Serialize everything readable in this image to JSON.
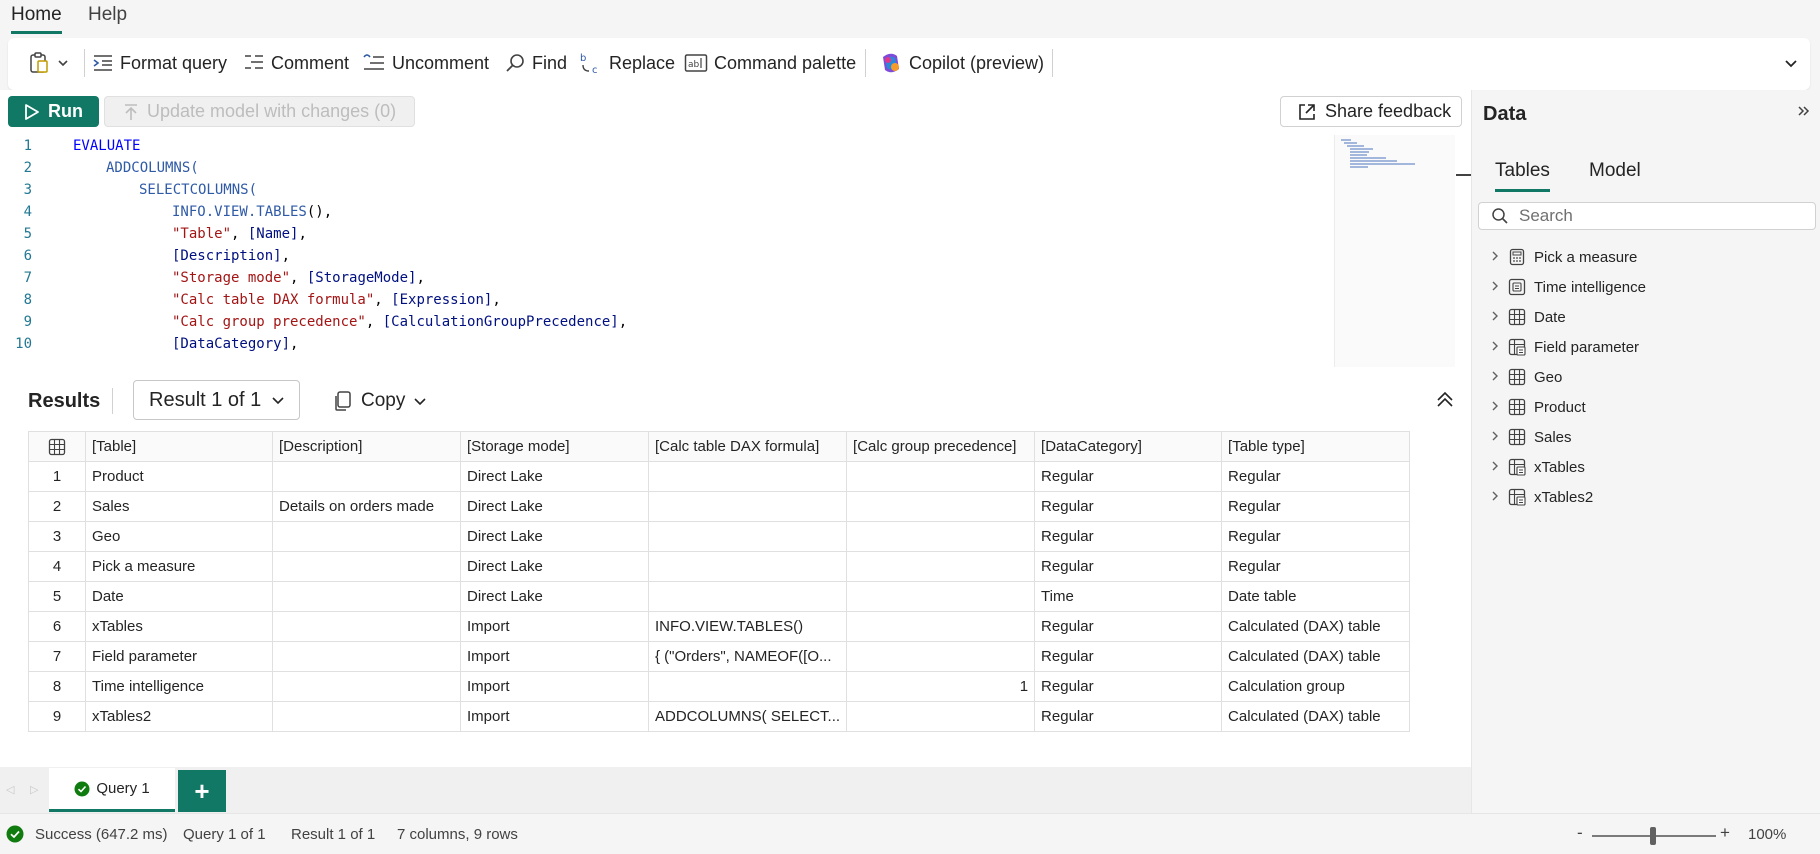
{
  "menu": {
    "tabs": [
      {
        "label": "Home"
      },
      {
        "label": "Help"
      }
    ]
  },
  "ribbon": {
    "format_query": "Format query",
    "comment": "Comment",
    "uncomment": "Uncomment",
    "find": "Find",
    "replace": "Replace",
    "command_palette": "Command palette",
    "copilot": "Copilot (preview)"
  },
  "toolbar": {
    "run": "Run",
    "update_model": "Update model with changes (0)",
    "share_feedback": "Share feedback"
  },
  "code": {
    "lines": [
      {
        "n": "1",
        "indent": 0,
        "parts": [
          {
            "t": "EVALUATE",
            "c": "kw"
          }
        ]
      },
      {
        "n": "2",
        "indent": 1,
        "parts": [
          {
            "t": "ADDCOLUMNS(",
            "c": "fn"
          }
        ]
      },
      {
        "n": "3",
        "indent": 2,
        "parts": [
          {
            "t": "SELECTCOLUMNS(",
            "c": "fn"
          }
        ]
      },
      {
        "n": "4",
        "indent": 3,
        "parts": [
          {
            "t": "INFO.VIEW.TABLES",
            "c": "fn"
          },
          {
            "t": "(),",
            "c": "pu"
          }
        ]
      },
      {
        "n": "5",
        "indent": 3,
        "parts": [
          {
            "t": "\"Table\"",
            "c": "str"
          },
          {
            "t": ", ",
            "c": "pu"
          },
          {
            "t": "[Name]",
            "c": "col"
          },
          {
            "t": ",",
            "c": "pu"
          }
        ]
      },
      {
        "n": "6",
        "indent": 3,
        "parts": [
          {
            "t": "[Description]",
            "c": "col"
          },
          {
            "t": ",",
            "c": "pu"
          }
        ]
      },
      {
        "n": "7",
        "indent": 3,
        "parts": [
          {
            "t": "\"Storage mode\"",
            "c": "str"
          },
          {
            "t": ", ",
            "c": "pu"
          },
          {
            "t": "[StorageMode]",
            "c": "col"
          },
          {
            "t": ",",
            "c": "pu"
          }
        ]
      },
      {
        "n": "8",
        "indent": 3,
        "parts": [
          {
            "t": "\"Calc table DAX formula\"",
            "c": "str"
          },
          {
            "t": ", ",
            "c": "pu"
          },
          {
            "t": "[Expression]",
            "c": "col"
          },
          {
            "t": ",",
            "c": "pu"
          }
        ]
      },
      {
        "n": "9",
        "indent": 3,
        "parts": [
          {
            "t": "\"Calc group precedence\"",
            "c": "str"
          },
          {
            "t": ", ",
            "c": "pu"
          },
          {
            "t": "[CalculationGroupPrecedence]",
            "c": "col"
          },
          {
            "t": ",",
            "c": "pu"
          }
        ]
      },
      {
        "n": "10",
        "indent": 3,
        "parts": [
          {
            "t": "[DataCategory]",
            "c": "col"
          },
          {
            "t": ",",
            "c": "pu"
          }
        ]
      }
    ]
  },
  "results": {
    "title": "Results",
    "selector": "Result 1 of 1",
    "copy": "Copy",
    "columns": [
      "[Table]",
      "[Description]",
      "[Storage mode]",
      "[Calc table DAX formula]",
      "[Calc group precedence]",
      "[DataCategory]",
      "[Table type]"
    ],
    "rows": [
      [
        "1",
        "Product",
        "",
        "Direct Lake",
        "",
        "",
        "Regular",
        "Regular"
      ],
      [
        "2",
        "Sales",
        "Details on orders made",
        "Direct Lake",
        "",
        "",
        "Regular",
        "Regular"
      ],
      [
        "3",
        "Geo",
        "",
        "Direct Lake",
        "",
        "",
        "Regular",
        "Regular"
      ],
      [
        "4",
        "Pick a measure",
        "",
        "Direct Lake",
        "",
        "",
        "Regular",
        "Regular"
      ],
      [
        "5",
        "Date",
        "",
        "Direct Lake",
        "",
        "",
        "Time",
        "Date table"
      ],
      [
        "6",
        "xTables",
        "",
        "Import",
        "INFO.VIEW.TABLES()",
        "",
        "Regular",
        "Calculated (DAX) table"
      ],
      [
        "7",
        "Field parameter",
        "",
        "Import",
        "{ (\"Orders\", NAMEOF([O...",
        "",
        "Regular",
        "Calculated (DAX) table"
      ],
      [
        "8",
        "Time intelligence",
        "",
        "Import",
        "",
        "1",
        "Regular",
        "Calculation group"
      ],
      [
        "9",
        "xTables2",
        "",
        "Import",
        "ADDCOLUMNS( SELECT...",
        "",
        "Regular",
        "Calculated (DAX) table"
      ]
    ]
  },
  "query_tabs": {
    "active": "Query 1",
    "add": "+"
  },
  "status": {
    "success": "Success (647.2 ms)",
    "query": "Query 1 of 1",
    "result": "Result 1 of 1",
    "dims": "7 columns, 9 rows",
    "zoom_minus": "-",
    "zoom_plus": "+",
    "zoom": "100%"
  },
  "data_pane": {
    "title": "Data",
    "tabs": [
      {
        "label": "Tables"
      },
      {
        "label": "Model"
      }
    ],
    "search_placeholder": "Search",
    "items": [
      {
        "label": "Pick a measure",
        "icon": "measure-table-icon"
      },
      {
        "label": "Time intelligence",
        "icon": "calc-group-icon"
      },
      {
        "label": "Date",
        "icon": "table-icon"
      },
      {
        "label": "Field parameter",
        "icon": "calc-table-icon"
      },
      {
        "label": "Geo",
        "icon": "table-icon"
      },
      {
        "label": "Product",
        "icon": "table-icon"
      },
      {
        "label": "Sales",
        "icon": "table-icon"
      },
      {
        "label": "xTables",
        "icon": "calc-table-icon"
      },
      {
        "label": "xTables2",
        "icon": "calc-table-icon"
      }
    ]
  },
  "colors": {
    "accent": "#117865",
    "keyword": "#0000ff",
    "function": "#2f5aa6",
    "string": "#a31515",
    "column": "#001080",
    "line_number": "#237893",
    "success": "#107c10"
  }
}
